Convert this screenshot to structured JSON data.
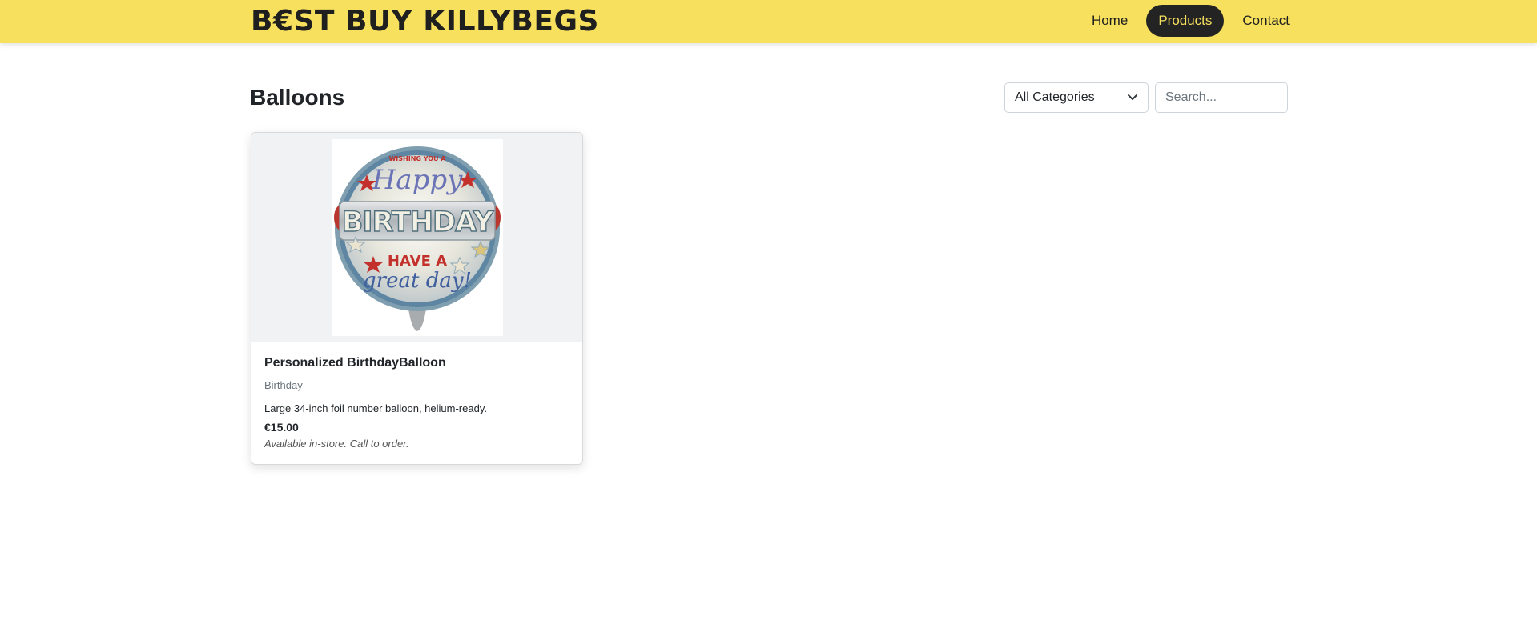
{
  "header": {
    "brand": "B€ST BUY KILLYBEGS",
    "nav": [
      {
        "label": "Home",
        "active": false
      },
      {
        "label": "Products",
        "active": true
      },
      {
        "label": "Contact",
        "active": false
      }
    ],
    "background_color": "#f6e05e",
    "active_color": "#232323"
  },
  "main": {
    "title": "Balloons",
    "filters": {
      "category_selected": "All Categories",
      "search_placeholder": "Search..."
    },
    "products": [
      {
        "name": "Personalized BirthdayBalloon",
        "category": "Birthday",
        "description": "Large 34-inch foil number balloon, helium-ready.",
        "price": "€15.00",
        "availability": "Available in-store. Call to order.",
        "image": {
          "top_text": "WISHING YOU A",
          "line1": "Happy",
          "line2": "BIRTHDAY",
          "line3": "HAVE A",
          "line4": "great day!"
        }
      }
    ]
  }
}
